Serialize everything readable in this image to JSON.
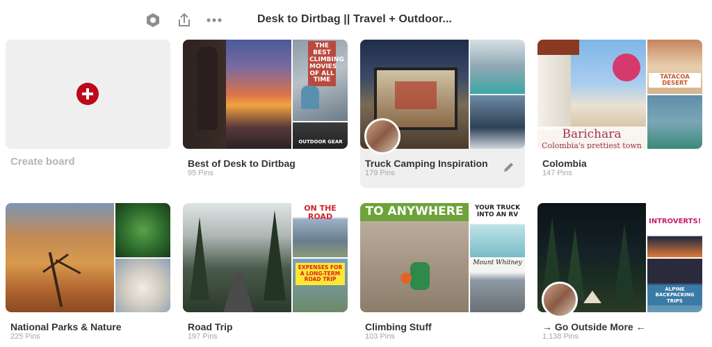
{
  "header": {
    "title": "Desk to Dirtbag || Travel + Outdoor...",
    "icons": [
      "settings-hexagon-icon",
      "share-icon",
      "more-icon"
    ]
  },
  "create": {
    "label": "Create board"
  },
  "boards": [
    {
      "name": "Best of Desk to Dirtbag",
      "pins": "95 Pins",
      "cover_text": {
        "best": "THE BEST CLIMBING MOVIES OF ALL TIME",
        "gear": "OUTDOOR GEAR"
      }
    },
    {
      "name": "Truck Camping Inspiration",
      "pins": "179 Pins"
    },
    {
      "name": "Colombia",
      "pins": "147 Pins",
      "cover_text": {
        "desert": "TATACOA DESERT",
        "barichara": "Barichara",
        "sub": "Colombia's prettiest town"
      }
    },
    {
      "name": "National Parks & Nature",
      "pins": "225 Pins"
    },
    {
      "name": "Road Trip",
      "pins": "197 Pins",
      "cover_text": {
        "road": "ON THE ROAD",
        "expenses": "EXPENSES FOR A LONG-TERM ROAD TRIP"
      }
    },
    {
      "name": "Climbing Stuff",
      "pins": "103 Pins",
      "cover_text": {
        "anywhere": "TO ANYWHERE",
        "truck": "YOUR TRUCK INTO AN RV",
        "whitney": "Mount Whitney"
      }
    },
    {
      "name": "→ Go Outside More ←",
      "pins": "1,138 Pins",
      "cover_text": {
        "introverts": "INTROVERTS!",
        "alpine": "ALPINE BACKPACKING TRIPS"
      }
    }
  ]
}
